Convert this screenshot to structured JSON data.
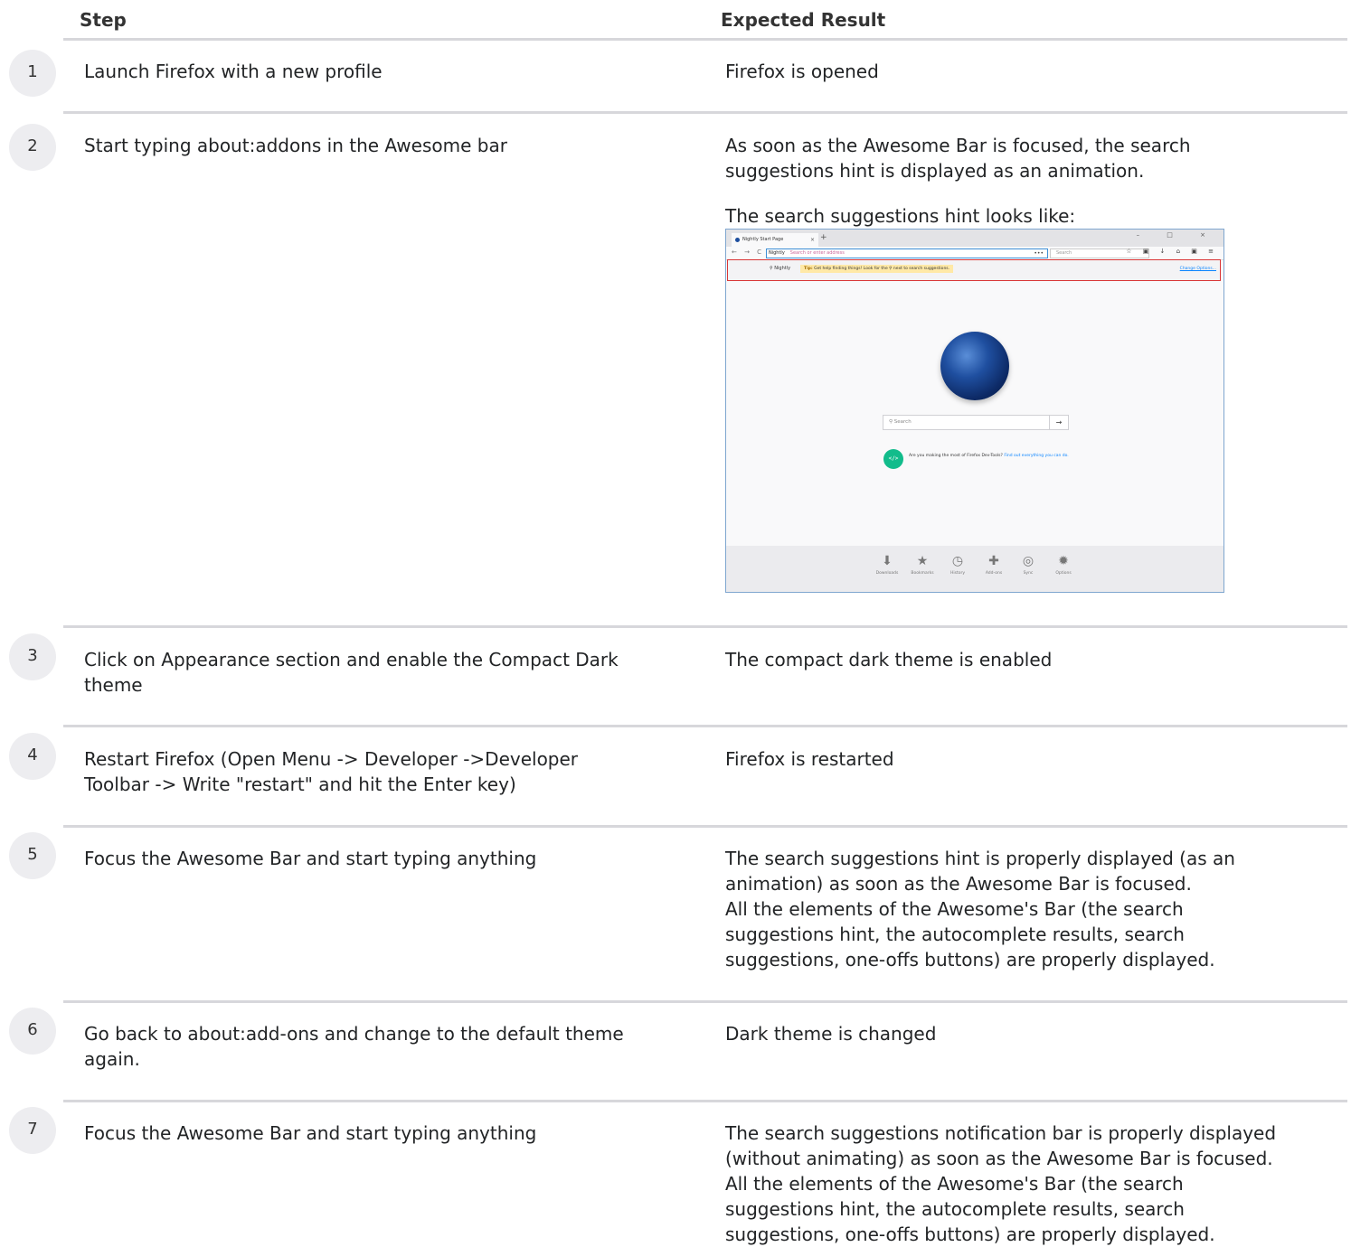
{
  "table": {
    "header": {
      "step": "Step",
      "expected": "Expected Result"
    },
    "rows": [
      {
        "num": "1",
        "step": "Launch Firefox with a new profile",
        "expected": "Firefox is opened"
      },
      {
        "num": "2",
        "step": "Start typing about:addons in the Awesome bar",
        "expected": "As soon as the Awesome Bar is focused, the search\nsuggestions hint is displayed as an animation.",
        "expected_extra": "The search suggestions hint looks like:"
      },
      {
        "num": "3",
        "step": "Click on Appearance section and enable the Compact Dark\ntheme",
        "expected": "The compact dark theme is enabled"
      },
      {
        "num": "4",
        "step": "Restart Firefox (Open Menu -> Developer ->Developer\nToolbar -> Write \"restart\" and hit the Enter key)",
        "expected": "Firefox is restarted"
      },
      {
        "num": "5",
        "step": "Focus the Awesome Bar and start typing anything",
        "expected": "The search suggestions hint is properly displayed (as an\nanimation) as soon as the Awesome Bar is focused.\nAll the elements of the Awesome's Bar (the search\nsuggestions hint, the autocomplete results, search\nsuggestions, one-offs buttons) are properly displayed."
      },
      {
        "num": "6",
        "step": "Go back to about:add-ons and change to the default theme\nagain.",
        "expected": "Dark theme is changed"
      },
      {
        "num": "7",
        "step": "Focus the Awesome Bar and start typing anything",
        "expected": "The search suggestions notification bar is properly displayed\n(without animating) as soon as the Awesome Bar is focused.\nAll the elements of the Awesome's Bar (the search\nsuggestions hint, the autocomplete results, search\nsuggestions, one-offs buttons) are properly displayed."
      }
    ]
  },
  "screenshot": {
    "tab_title": "Nightly Start Page",
    "tab_close": "×",
    "new_tab": "+",
    "window_controls": "–  □  ×",
    "nav_icons": "← → C",
    "identity_label": "Nightly",
    "url_placeholder": "Search or enter address",
    "url_more": "•••",
    "search_placeholder": "Search",
    "toolbar_icons": "☆ ▣ ↓ ⌂ ▣ ≡",
    "hint_search_label": "Nightly",
    "hint_tip_bold": "Tip:",
    "hint_tip_text": "Get help finding things! Look for the",
    "hint_tip_text2": "next to search suggestions.",
    "hint_change_options": "Change Options...",
    "content_search_placeholder": "Search",
    "content_search_go": "→",
    "snippet_icon": "</>",
    "snippet_text": "Are you making the most of Firefox Dev-Tools?",
    "snippet_link": "Find out everything you can do.",
    "footer": [
      {
        "label": "Downloads",
        "icon": "download-icon",
        "glyph": "⬇"
      },
      {
        "label": "Bookmarks",
        "icon": "bookmark-icon",
        "glyph": "★"
      },
      {
        "label": "History",
        "icon": "history-icon",
        "glyph": "◷"
      },
      {
        "label": "Add-ons",
        "icon": "addons-icon",
        "glyph": "✚"
      },
      {
        "label": "Sync",
        "icon": "sync-icon",
        "glyph": "◎"
      },
      {
        "label": "Options",
        "icon": "options-icon",
        "glyph": "✹"
      }
    ]
  }
}
